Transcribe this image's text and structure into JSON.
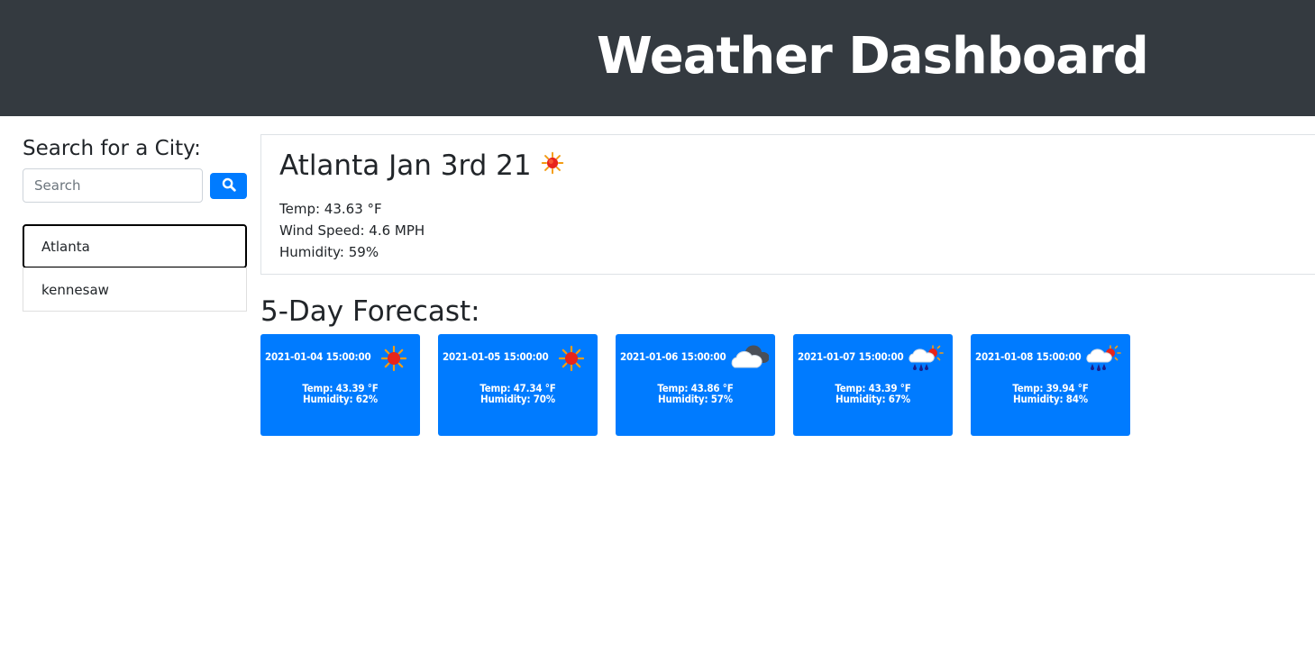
{
  "header": {
    "title": "Weather Dashboard"
  },
  "search": {
    "heading": "Search for a City:",
    "placeholder": "Search",
    "value": "",
    "button_icon": "search-icon"
  },
  "history": [
    {
      "label": "Atlanta",
      "active": true
    },
    {
      "label": "kennesaw",
      "active": false
    }
  ],
  "current": {
    "title": "Atlanta Jan 3rd 21",
    "icon": "sun-icon",
    "temp": "Temp: 43.63 °F",
    "wind": "Wind Speed: 4.6 MPH",
    "humidity": "Humidity: 59%"
  },
  "forecast": {
    "heading": "5-Day Forecast:",
    "days": [
      {
        "date": "2021-01-04 15:00:00",
        "icon": "sun-icon",
        "temp": "Temp: 43.39 °F",
        "humidity": "Humidity: 62%"
      },
      {
        "date": "2021-01-05 15:00:00",
        "icon": "sun-icon",
        "temp": "Temp: 47.34 °F",
        "humidity": "Humidity: 70%"
      },
      {
        "date": "2021-01-06 15:00:00",
        "icon": "cloud-icon",
        "temp": "Temp: 43.86 °F",
        "humidity": "Humidity: 57%"
      },
      {
        "date": "2021-01-07 15:00:00",
        "icon": "rain-sun-icon",
        "temp": "Temp: 43.39 °F",
        "humidity": "Humidity: 67%"
      },
      {
        "date": "2021-01-08 15:00:00",
        "icon": "rain-sun-icon",
        "temp": "Temp: 39.94 °F",
        "humidity": "Humidity: 84%"
      }
    ]
  },
  "colors": {
    "header_bg": "#343a40",
    "primary": "#007bff",
    "text": "#212529"
  }
}
